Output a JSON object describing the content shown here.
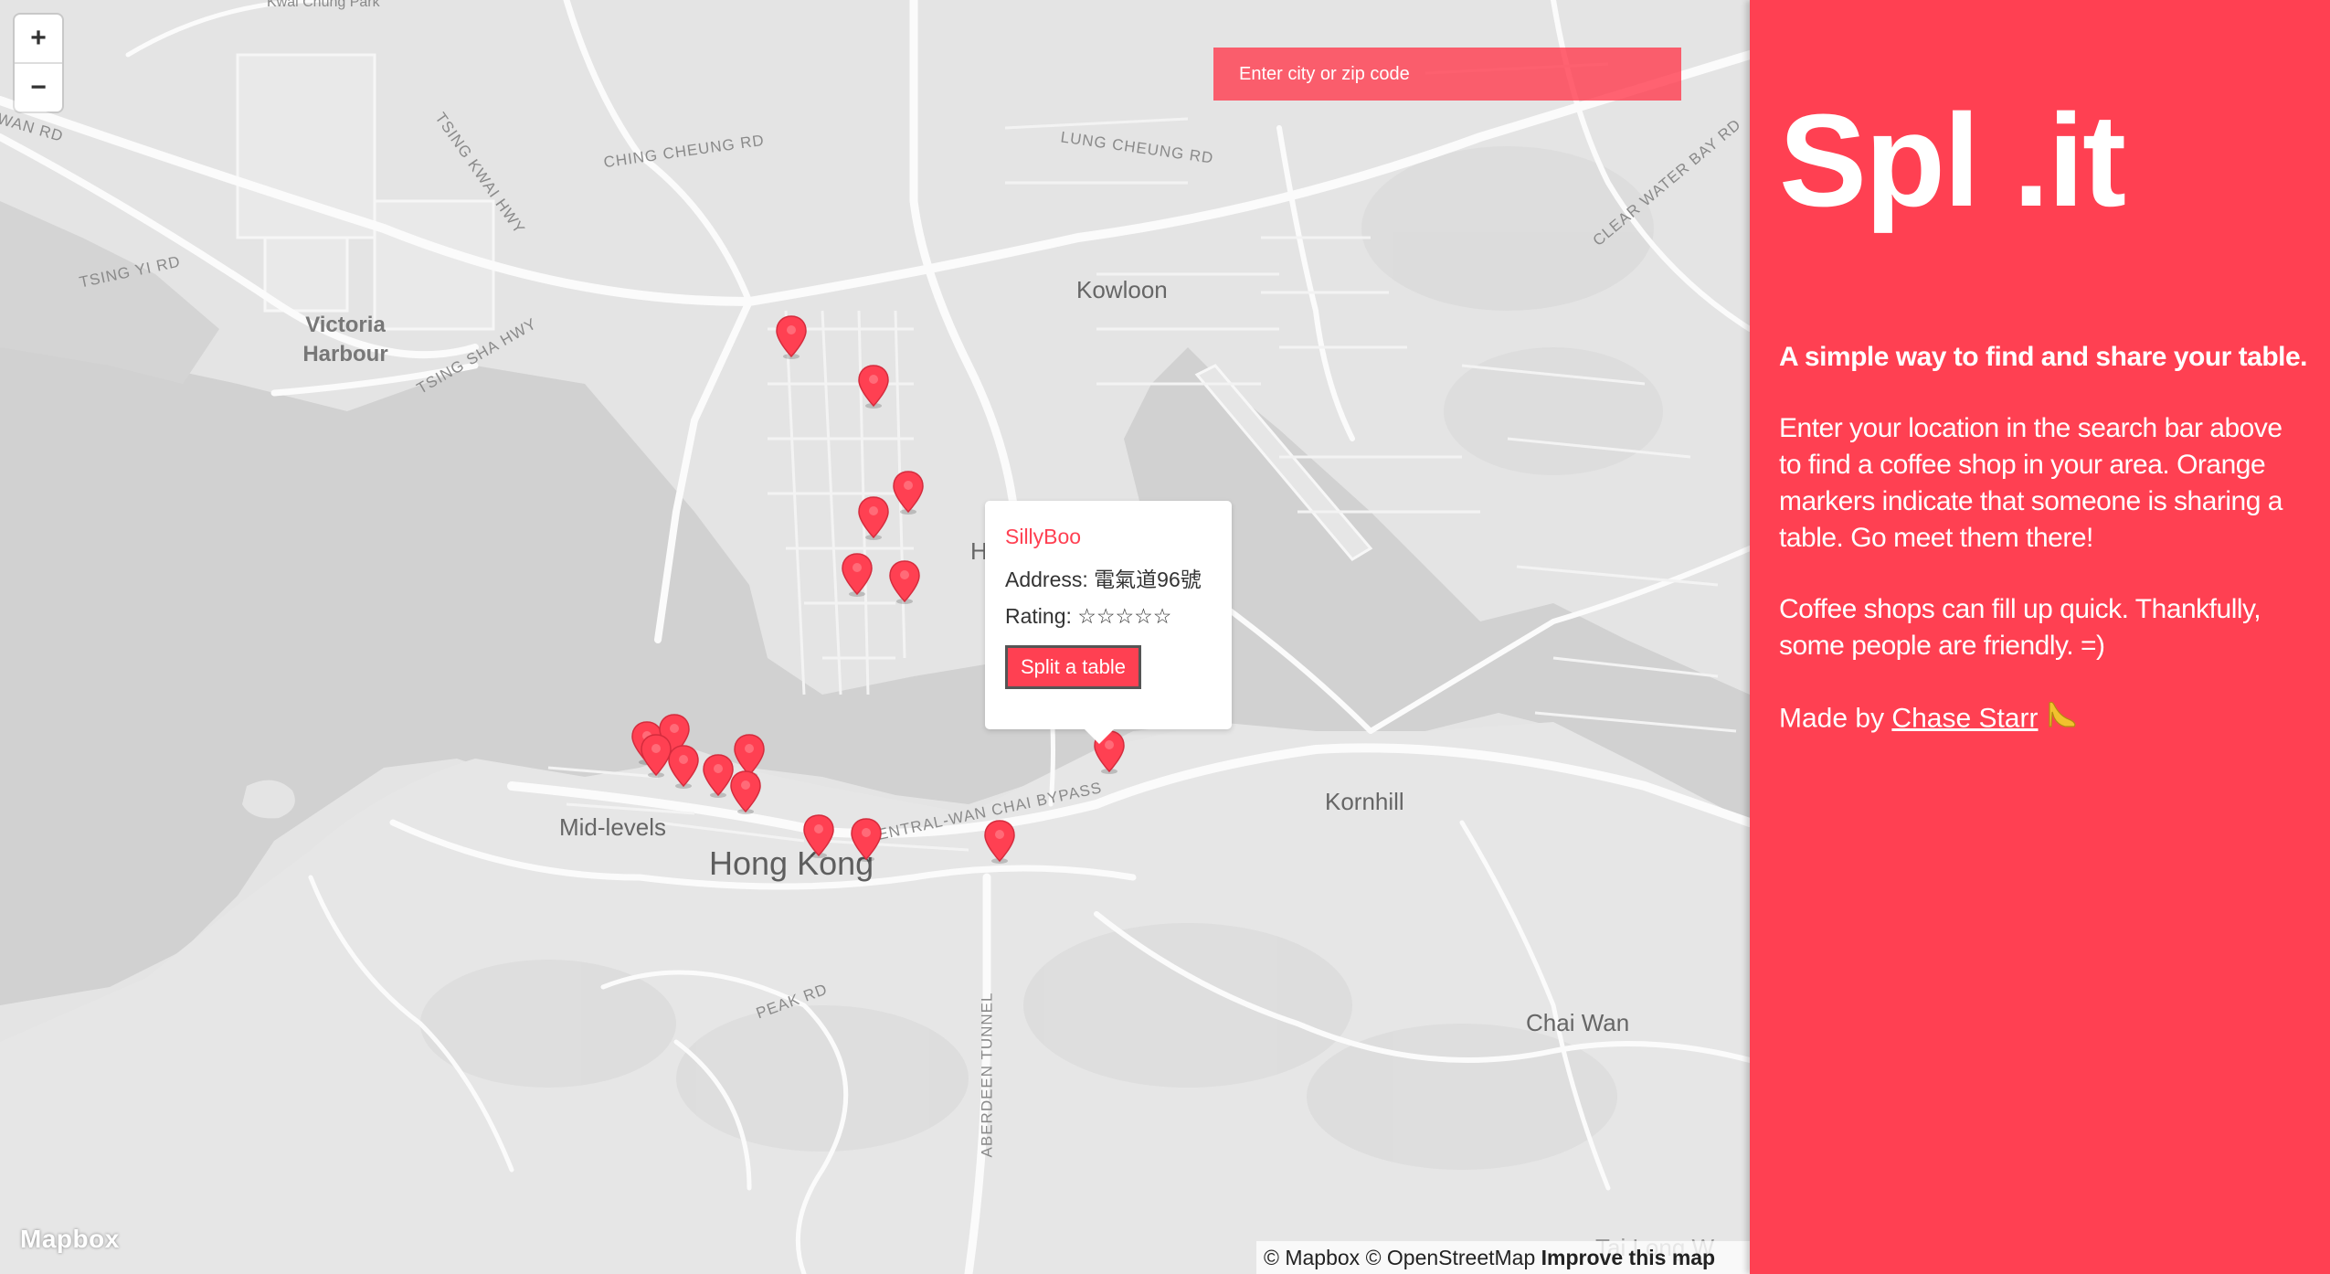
{
  "map": {
    "zoom_in": "+",
    "zoom_out": "−",
    "search_placeholder": "Enter city or zip code",
    "labels": {
      "kwai_chung_park": "Kwai Chung Park",
      "wan_rd": "WAN RD",
      "ching_cheung_rd": "CHING CHEUNG RD",
      "lung_cheung_rd": "LUNG CHEUNG RD",
      "tsing_kwai_hwy": "TSING KWAI HWY",
      "tsing_yi_rd": "TSING YI RD",
      "victoria_harbour": "Victoria Harbour",
      "tsing_sha_hwy": "TSING SHA HWY",
      "clear_water_bay_rd": "CLEAR WATER BAY RD",
      "kowloon": "Kowloon",
      "h_partial": "H",
      "kornhill": "Kornhill",
      "mid_levels": "Mid-levels",
      "hong_kong": "Hong Kong",
      "wan_chai_bypass": "ENTRAL-WAN CHAI BYPASS",
      "peak_rd": "PEAK RD",
      "aberdeen_tunnel": "ABERDEEN TUNNEL",
      "chai_wan": "Chai Wan",
      "tai_long_wan": "Tai Long W"
    },
    "logo": "Mapbox",
    "attribution": {
      "mapbox": "© Mapbox",
      "osm": "© OpenStreetMap",
      "improve": "Improve this map"
    },
    "marker_color": "#ff4052"
  },
  "popup": {
    "name": "SillyBoo",
    "address": "Address: 電氣道96號",
    "rating": "Rating: ☆☆☆☆☆",
    "button": "Split a table"
  },
  "sidebar": {
    "brand": "Spl .it",
    "tagline": "A simple way to find and share your table.",
    "paragraph1": "Enter your location in the search bar above to find a coffee shop in your area. Orange markers indicate that someone is sharing a table. Go meet them there!",
    "paragraph2": "Coffee shops can fill up quick. Thankfully, some people are friendly. =)",
    "made_by_prefix": "Made by ",
    "made_by_name": "Chase Starr",
    "accent_color": "#ff4052"
  }
}
